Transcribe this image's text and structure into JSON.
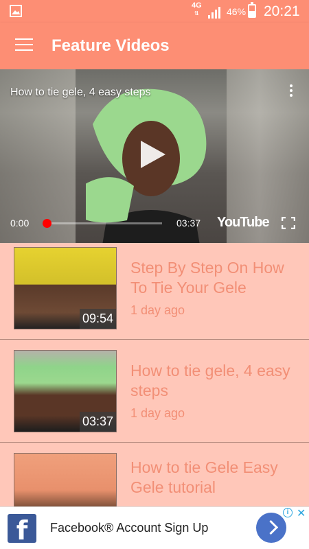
{
  "status_bar": {
    "network": "4G",
    "battery": "46%",
    "time": "20:21"
  },
  "app_bar": {
    "title": "Feature Videos"
  },
  "player": {
    "title": "How to tie gele,  4 easy steps",
    "current_time": "0:00",
    "duration": "03:37",
    "brand": "YouTube",
    "progress_fraction": 0.0
  },
  "videos": [
    {
      "title": "Step By Step On How To Tie Your Gele",
      "age": "1 day ago",
      "duration": "09:54",
      "thumb_color": "#e6d230"
    },
    {
      "title": "How to tie gele,  4 easy steps",
      "age": "1 day ago",
      "duration": "03:37",
      "thumb_color": "#8fd48a"
    },
    {
      "title": "How to tie Gele   Easy Gele tutorial",
      "age": "",
      "duration": "",
      "thumb_color": "#f0a07c"
    }
  ],
  "ad": {
    "text": "Facebook® Account Sign Up",
    "logo_letter": "f",
    "info_symbol": "i",
    "close_symbol": "✕"
  },
  "colors": {
    "primary": "#fd8e74",
    "background": "#ffc7b9",
    "text_accent": "#f28f76"
  }
}
